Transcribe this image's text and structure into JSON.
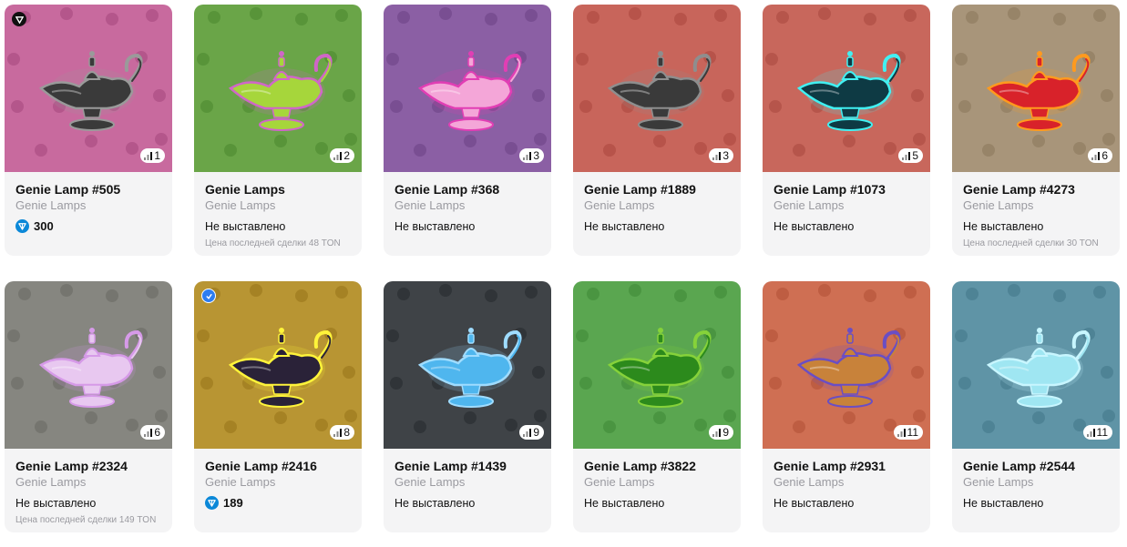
{
  "colors": {
    "card_bg": "#f4f4f5",
    "ton_blue": "#0b88d8",
    "muted": "#9a9aa0"
  },
  "cards": [
    {
      "name": "Genie Lamp #505",
      "collection": "Genie Lamps",
      "rank": "1",
      "price": "300",
      "status": "",
      "last_sale": "",
      "bg": "#c86a9e",
      "pattern": "#b15488",
      "lamp": "#3a3a3a",
      "glow": "#9a9a9a",
      "corner_icon": "verified-mark-icon"
    },
    {
      "name": "Genie Lamps",
      "collection": "Genie Lamps",
      "rank": "2",
      "price": "",
      "status": "Не выставлено",
      "last_sale": "Цена последней сделки 48 TON",
      "bg": "#6aa548",
      "pattern": "#579237",
      "lamp": "#a6d63b",
      "glow": "#d066c8",
      "corner_icon": ""
    },
    {
      "name": "Genie Lamp #368",
      "collection": "Genie Lamps",
      "rank": "3",
      "price": "",
      "status": "Не выставлено",
      "last_sale": "",
      "bg": "#8b5fa4",
      "pattern": "#774c90",
      "lamp": "#f4a6d8",
      "glow": "#e13eb4",
      "corner_icon": ""
    },
    {
      "name": "Genie Lamp #1889",
      "collection": "Genie Lamps",
      "rank": "3",
      "price": "",
      "status": "Не выставлено",
      "last_sale": "",
      "bg": "#c8655b",
      "pattern": "#b55148",
      "lamp": "#3a3a3a",
      "glow": "#8e8e8e",
      "corner_icon": ""
    },
    {
      "name": "Genie Lamp #1073",
      "collection": "Genie Lamps",
      "rank": "5",
      "price": "",
      "status": "Не выставлено",
      "last_sale": "",
      "bg": "#c8675c",
      "pattern": "#b45349",
      "lamp": "#0e3a44",
      "glow": "#41f0f2",
      "corner_icon": ""
    },
    {
      "name": "Genie Lamp #4273",
      "collection": "Genie Lamps",
      "rank": "6",
      "price": "",
      "status": "Не выставлено",
      "last_sale": "Цена последней сделки 30 TON",
      "bg": "#a8957a",
      "pattern": "#958266",
      "lamp": "#d8222a",
      "glow": "#ff9a1e",
      "corner_icon": ""
    },
    {
      "name": "Genie Lamp #2324",
      "collection": "Genie Lamps",
      "rank": "6",
      "price": "",
      "status": "Не выставлено",
      "last_sale": "Цена последней сделки 149 TON",
      "bg": "#868680",
      "pattern": "#73736d",
      "lamp": "#e8c8f0",
      "glow": "#d69ae8",
      "corner_icon": ""
    },
    {
      "name": "Genie Lamp #2416",
      "collection": "Genie Lamps",
      "rank": "8",
      "price": "189",
      "status": "",
      "last_sale": "",
      "bg": "#b89533",
      "pattern": "#a38022",
      "lamp": "#2a2238",
      "glow": "#fff43a",
      "corner_icon": "blue-badge-icon"
    },
    {
      "name": "Genie Lamp #1439",
      "collection": "Genie Lamps",
      "rank": "9",
      "price": "",
      "status": "Не выставлено",
      "last_sale": "",
      "bg": "#3f4347",
      "pattern": "#2f3336",
      "lamp": "#4fb6ee",
      "glow": "#9fdcff",
      "corner_icon": ""
    },
    {
      "name": "Genie Lamp #3822",
      "collection": "Genie Lamps",
      "rank": "9",
      "price": "",
      "status": "Не выставлено",
      "last_sale": "",
      "bg": "#5aa650",
      "pattern": "#48933f",
      "lamp": "#2c8a1c",
      "glow": "#86d23a",
      "corner_icon": ""
    },
    {
      "name": "Genie Lamp #2931",
      "collection": "Genie Lamps",
      "rank": "11",
      "price": "",
      "status": "Не выставлено",
      "last_sale": "",
      "bg": "#cf6f53",
      "pattern": "#bb5b40",
      "lamp": "#c8823a",
      "glow": "#6a4ec4",
      "corner_icon": ""
    },
    {
      "name": "Genie Lamp #2544",
      "collection": "Genie Lamps",
      "rank": "11",
      "price": "",
      "status": "Не выставлено",
      "last_sale": "",
      "bg": "#5f94a6",
      "pattern": "#4d8193",
      "lamp": "#9fe6f2",
      "glow": "#c8f6ff",
      "corner_icon": ""
    }
  ]
}
